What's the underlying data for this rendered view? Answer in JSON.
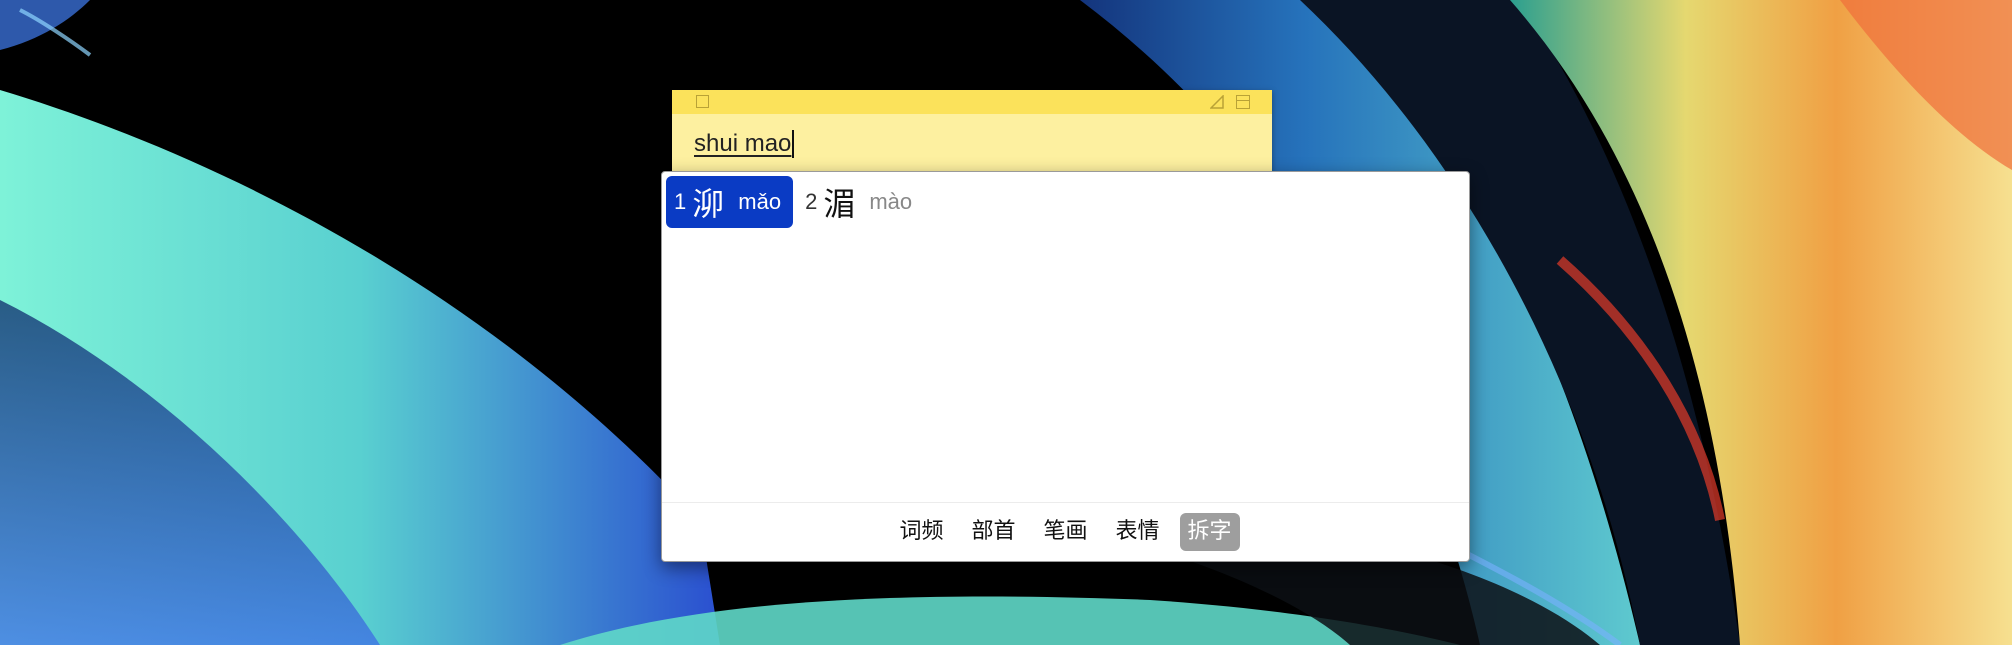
{
  "sticky_note": {
    "composing_text": "shui mao"
  },
  "ime": {
    "candidates": [
      {
        "index": "1",
        "char": "泖",
        "pinyin": "mǎo",
        "selected": true
      },
      {
        "index": "2",
        "char": "湄",
        "pinyin": "mào",
        "selected": false
      }
    ],
    "tabs": [
      {
        "label": "词频",
        "active": false
      },
      {
        "label": "部首",
        "active": false
      },
      {
        "label": "笔画",
        "active": false
      },
      {
        "label": "表情",
        "active": false
      },
      {
        "label": "拆字",
        "active": true
      }
    ]
  },
  "colors": {
    "sticky_bg": "#fdf0a0",
    "sticky_titlebar": "#fbe25b",
    "selection": "#0a3bc4",
    "active_tab": "#9e9e9e"
  }
}
